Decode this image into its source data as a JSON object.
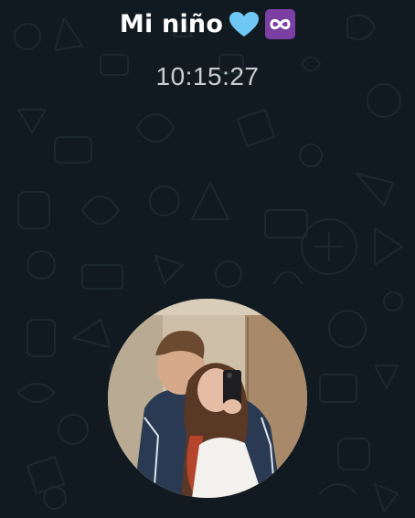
{
  "call": {
    "contact_name": "Mi niño",
    "name_emoji": [
      "blue-heart-icon",
      "infinity-icon"
    ],
    "timer": "10:15:27"
  },
  "avatar": {
    "description_icon": "profile-photo"
  },
  "colors": {
    "background": "#111a20",
    "pattern": "#1d2a31",
    "heart": "#6fc8f3",
    "infinity_bg": "#7b3fa3",
    "timer_text": "#c9cdd0"
  }
}
